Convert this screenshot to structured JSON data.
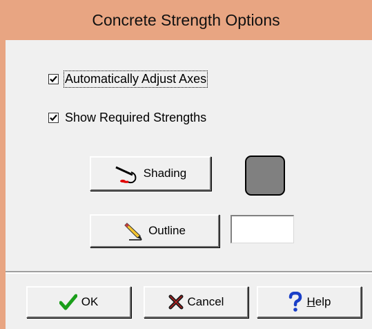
{
  "window": {
    "title": "Concrete Strength Options"
  },
  "options": {
    "auto_adjust_axes": {
      "label": "Automatically Adjust Axes",
      "checked": true
    },
    "show_required_strengths": {
      "label": "Show Required Strengths",
      "checked": true
    }
  },
  "shading": {
    "button_label": "Shading",
    "icon": "paint-brush-icon",
    "color": "#808080"
  },
  "outline": {
    "button_label": "Outline",
    "icon": "pencil-icon",
    "color": "#ffffff"
  },
  "footer": {
    "ok_label": "OK",
    "cancel_label": "Cancel",
    "help_label_prefix": "",
    "help_label_mnemonic": "H",
    "help_label_rest": "elp"
  },
  "colors": {
    "titlebar": "#e8a582",
    "client": "#f0f0f0",
    "ok_icon": "#1a9e1a",
    "cancel_icon": "#1a1a1a",
    "help_icon": "#1a3fc7"
  }
}
